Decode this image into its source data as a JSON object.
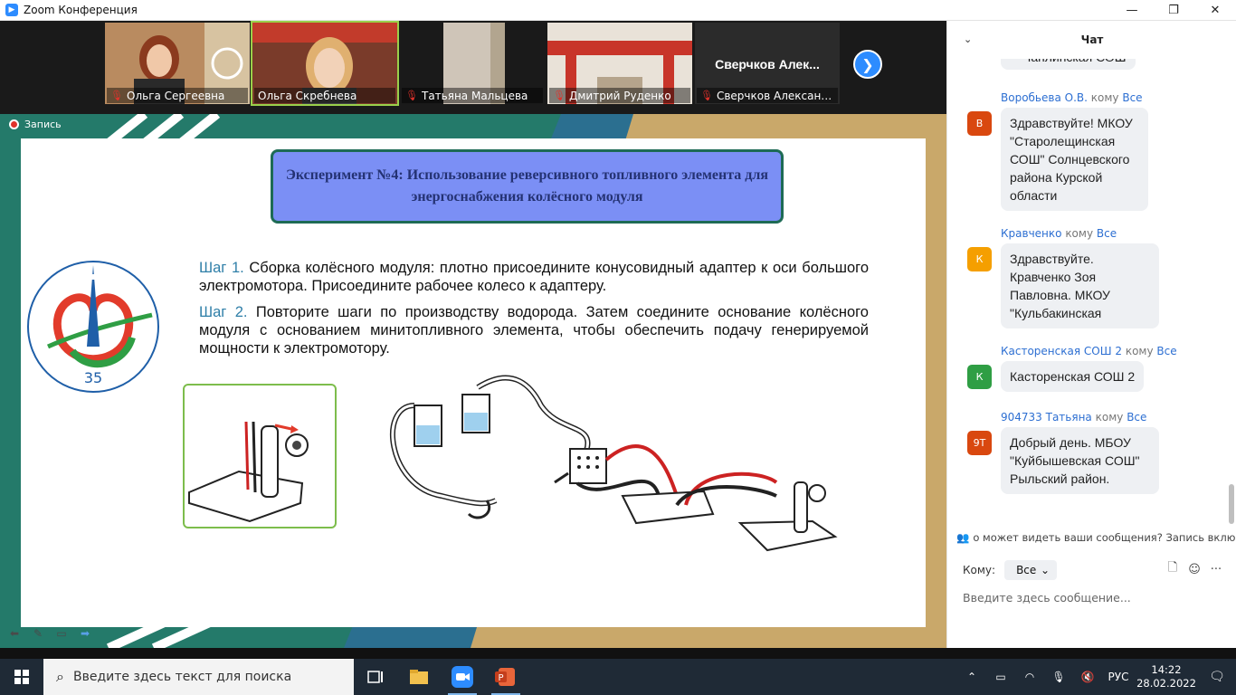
{
  "window": {
    "title": "Zoom Конференция",
    "controls": [
      "—",
      "❐",
      "✕"
    ]
  },
  "participants": [
    {
      "name": "Ольга Сергеевна",
      "muted": true,
      "active": false
    },
    {
      "name": "Ольга Скребнева",
      "muted": false,
      "active": true
    },
    {
      "name": "Татьяна Мальцева",
      "muted": true,
      "active": false
    },
    {
      "name": "Дмитрий Руденко",
      "muted": true,
      "active": false
    },
    {
      "name": "Сверчков Александр...",
      "muted": true,
      "active": false,
      "display_name": "Сверчков  Алек..."
    }
  ],
  "next_arrow": "❯",
  "recording": {
    "label": "Запись"
  },
  "slide": {
    "title": "Эксперимент №4: Использование реверсивного топливного элемента для энергоснабжения колёсного модуля",
    "step1_label": "Шаг 1.",
    "step1_text": " Сборка колёсного модуля: плотно присоедините конусовидный адаптер к оси большого электромотора. Присоедините рабочее колесо к адаптеру.",
    "step2_label": "Шаг 2.",
    "step2_text": " Повторите шаги по производству водорода. Затем соедините основание колёсного модуля с основанием минитопливного элемента, чтобы обеспечить подачу генерируемой мощности к электромотору."
  },
  "chat": {
    "title": "Чат",
    "to_word": "кому",
    "messages": [
      {
        "sender": "",
        "recipient": "",
        "avatar": "",
        "avatar_color": "",
        "text": "Чаплинская СОШ"
      },
      {
        "sender": "Воробьева О.В.",
        "recipient": "Все",
        "avatar": "В",
        "avatar_color": "#d9480f",
        "text": "Здравствуйте! МКОУ \"Старолещинская СОШ\" Солнцевского района Курской области"
      },
      {
        "sender": "Кравченко",
        "recipient": "Все",
        "avatar": "К",
        "avatar_color": "#f59f00",
        "text": "Здравствуйте. Кравченко Зоя Павловна. МКОУ \"Кульбакинская"
      },
      {
        "sender": "Касторенская СОШ 2",
        "recipient": "Все",
        "avatar": "К",
        "avatar_color": "#2f9e44",
        "text": "Касторенская СОШ 2"
      },
      {
        "sender": "904733 Татьяна",
        "recipient": "Все",
        "avatar": "9Т",
        "avatar_color": "#d9480f",
        "text": "Добрый день. МБОУ \"Куйбышевская СОШ\" Рыльский район."
      }
    ],
    "notice": "о может видеть ваши сообщения? Запись включе",
    "to_label": "Кому:",
    "to_value": "Все",
    "input_placeholder": "Введите здесь сообщение..."
  },
  "taskbar": {
    "search_placeholder": "Введите здесь текст для поиска",
    "lang": "РУС",
    "time": "14:22",
    "date": "28.02.2022"
  },
  "colors": {
    "zoom_blue": "#2d8cff",
    "slide_box": "#7b8ff5",
    "link_blue": "#2d6fd2",
    "step_label": "#2f7fa8"
  }
}
